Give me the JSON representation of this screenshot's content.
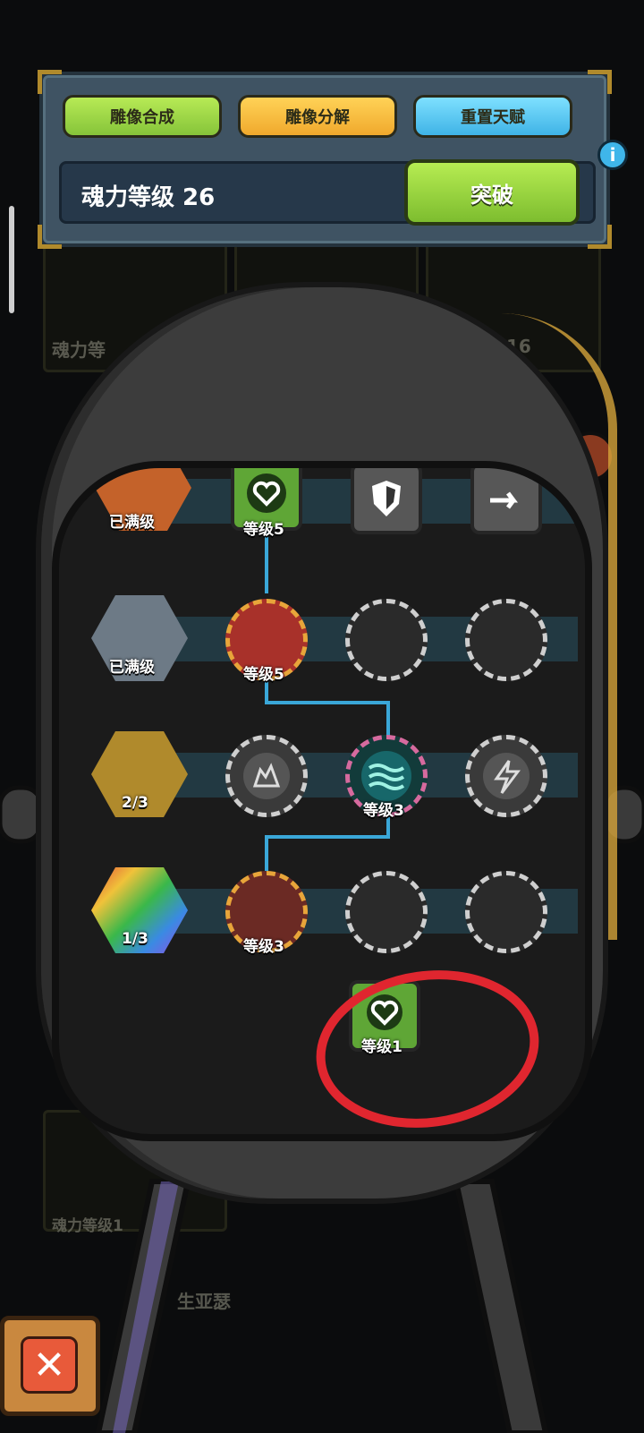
{
  "top_panel": {
    "buttons": {
      "compose": "雕像合成",
      "decompose": "雕像分解",
      "reset": "重置天赋"
    },
    "soul_level_label": "魂力等级 26",
    "breakthrough": "突破",
    "info": "i"
  },
  "background": {
    "text_1": "魂力等",
    "text_2": "16",
    "text_3": "魂力等级1",
    "text_4": "生亚瑟"
  },
  "tree": {
    "row0": {
      "statue_label": "已满级",
      "node1_label": "等级5"
    },
    "row1": {
      "statue_label": "已满级",
      "node1_label": "等级5"
    },
    "row2": {
      "statue_label": "2/3",
      "node2_label": "等级3"
    },
    "row3": {
      "statue_label": "1/3",
      "node1_label": "等级3"
    },
    "extra_node_label": "等级1"
  },
  "colors": {
    "accent_green": "#8bd13f",
    "accent_orange": "#f0a92d",
    "accent_blue": "#3fb3e6",
    "circle_annotation": "#e0262f"
  }
}
